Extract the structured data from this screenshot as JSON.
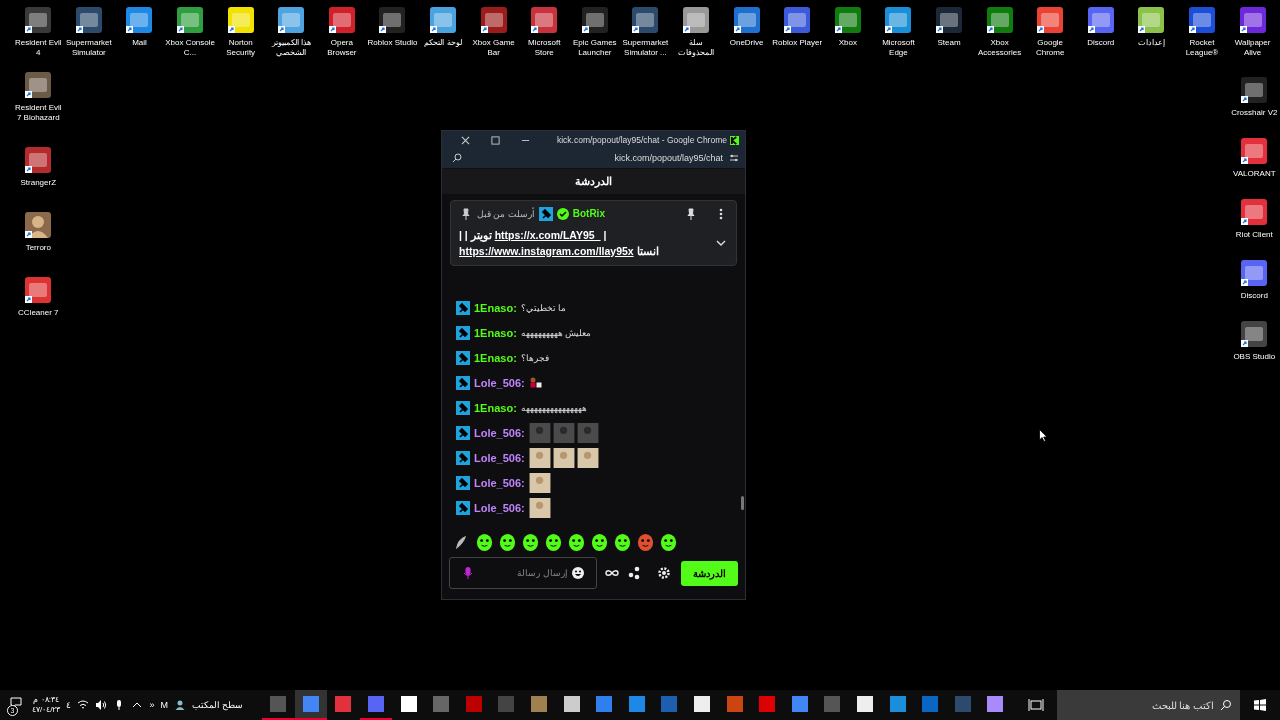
{
  "desktop": {
    "top_icons": [
      "Resident Evil 4",
      "Supermarket Simulator",
      "Mail",
      "Xbox Console C...",
      "Norton Security",
      "هذا الكمبيوتر الشخصي",
      "Opera Browser",
      "Roblox Studio",
      "لوحة التحكم",
      "Xbox Game Bar",
      "Microsoft Store",
      "Epic Games Launcher",
      "Supermarket Simulator ...",
      "سلة المحذوفات",
      "OneDrive",
      "Roblox Player",
      "Xbox",
      "Microsoft Edge",
      "Steam",
      "Xbox Accessories",
      "Google Chrome",
      "Discord",
      "إعدادات",
      "Rocket League®",
      "Wallpaper Alive"
    ],
    "left_icons": [
      "Resident Evil 7 Biohazard",
      "StrangerZ",
      "Terroro",
      "CCleaner 7"
    ],
    "right_icons": [
      "Crosshair V2",
      "VALORANT",
      "Riot Client",
      "Discord",
      "OBS Studio"
    ]
  },
  "chrome_window": {
    "title": "kick.com/popout/lay95/chat - Google Chrome",
    "address": "kick.com/popout/lay95/chat",
    "chat": {
      "header": "الدردشة",
      "pinned": {
        "sent_by": "أرسلت من قبل",
        "user": "BotRix",
        "lines": [
          {
            "parts": [
              {
                "kind": "text",
                "text": "| | تويتر"
              },
              {
                "kind": "link",
                "text": "https://x.com/LAY95_"
              },
              {
                "kind": "text",
                "text": "|"
              }
            ]
          },
          {
            "parts": [
              {
                "kind": "link",
                "text": "https://www.instagram.com/llay95x"
              },
              {
                "kind": "text",
                "text": "انستا"
              }
            ]
          }
        ]
      },
      "messages": [
        {
          "user": "1Enaso:",
          "color": "#53fc18",
          "kind": "text",
          "text": "ما تخطيتي؟"
        },
        {
          "user": "1Enaso:",
          "color": "#53fc18",
          "kind": "text",
          "text": "معليش هههههههههه"
        },
        {
          "user": "1Enaso:",
          "color": "#53fc18",
          "kind": "text",
          "text": "فجرها؟"
        },
        {
          "user": "Lole_506:",
          "color": "#c084fc",
          "kind": "emote"
        },
        {
          "user": "1Enaso:",
          "color": "#53fc18",
          "kind": "text",
          "text": "هههههههههههههههه"
        },
        {
          "user": "Lole_506:",
          "color": "#c084fc",
          "kind": "images",
          "images": [
            {
              "kind": "dark"
            },
            {
              "kind": "dark"
            },
            {
              "kind": "dark"
            }
          ]
        },
        {
          "user": "Lole_506:",
          "color": "#c084fc",
          "kind": "images",
          "images": [
            {
              "kind": "light"
            },
            {
              "kind": "light"
            },
            {
              "kind": "light"
            }
          ]
        },
        {
          "user": "Lole_506:",
          "color": "#c084fc",
          "kind": "images",
          "images": [
            {
              "kind": "light"
            }
          ]
        },
        {
          "user": "Lole_506:",
          "color": "#c084fc",
          "kind": "images",
          "images": [
            {
              "kind": "light"
            }
          ]
        }
      ],
      "input": {
        "placeholder": "إرسال رسالة"
      },
      "send_button": "الدردشة"
    }
  },
  "taskbar": {
    "notifications": "3",
    "time": "٠٨:٣٤ م",
    "date": "٤٧/٠٤/٢٣",
    "language": "٤",
    "overflow": "»",
    "tray_letter": "M",
    "toolbar": "سطح المكتب",
    "apps": [
      {
        "running": true,
        "selected": false
      },
      {
        "running": true,
        "selected": true
      },
      {
        "running": false,
        "selected": false
      },
      {
        "running": true,
        "selected": false
      },
      {
        "running": false,
        "selected": false
      },
      {
        "running": false,
        "selected": false
      },
      {
        "running": false,
        "selected": false
      },
      {
        "running": false,
        "selected": false
      },
      {
        "running": false,
        "selected": false
      },
      {
        "running": false,
        "selected": false
      },
      {
        "running": false,
        "selected": false
      },
      {
        "running": false,
        "selected": false
      },
      {
        "running": false,
        "selected": false
      },
      {
        "running": false,
        "selected": false
      },
      {
        "running": false,
        "selected": false
      },
      {
        "running": false,
        "selected": false
      },
      {
        "running": false,
        "selected": false
      },
      {
        "running": false,
        "selected": false
      },
      {
        "running": false,
        "selected": false
      },
      {
        "running": false,
        "selected": false
      },
      {
        "running": false,
        "selected": false
      },
      {
        "running": false,
        "selected": false
      },
      {
        "running": false,
        "selected": false
      }
    ],
    "search": {
      "placeholder": "اكتب هنا للبحث"
    }
  }
}
